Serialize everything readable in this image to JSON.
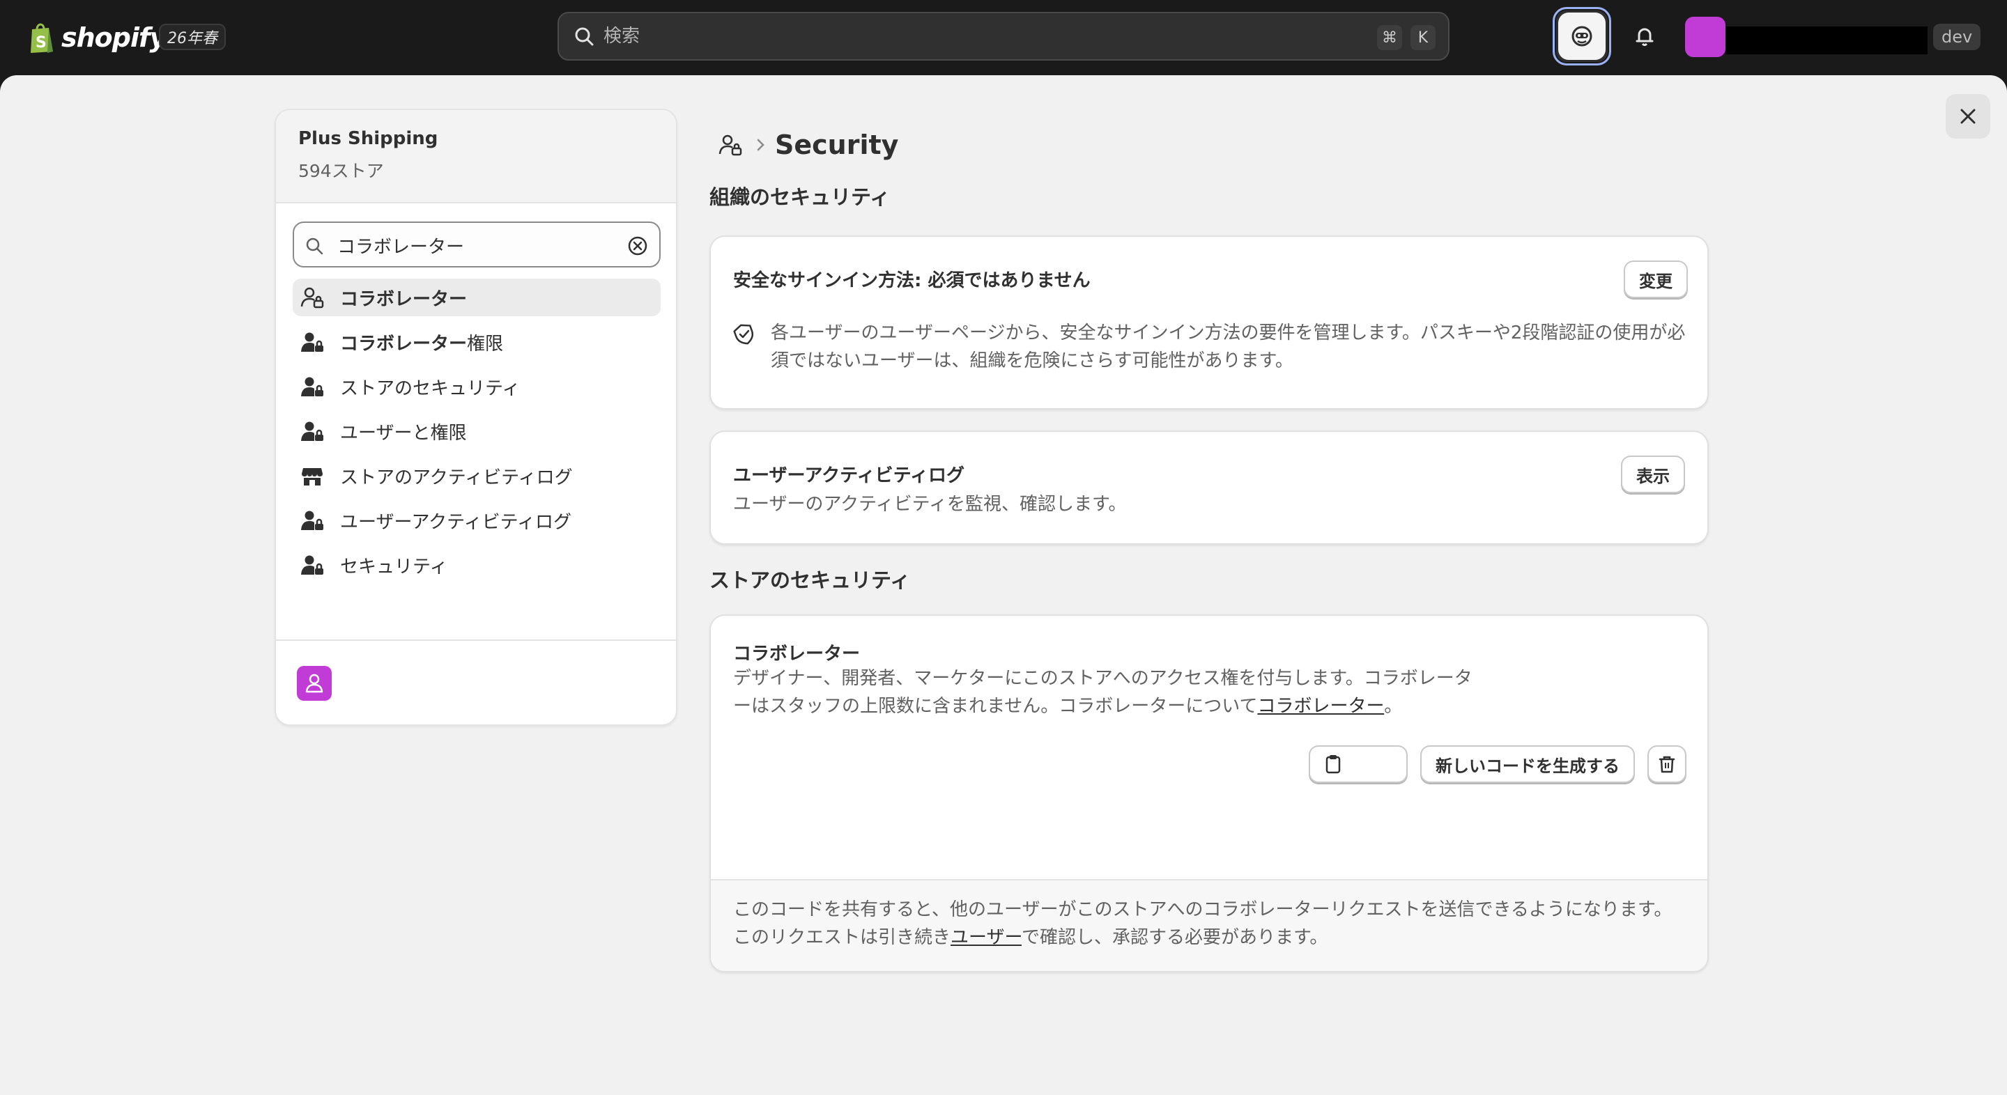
{
  "topbar": {
    "logo_text": "shopify",
    "season_badge": "26年春",
    "search_placeholder": "検索",
    "kbd_cmd": "⌘",
    "kbd_k": "K",
    "dev_badge": "dev"
  },
  "sidebar": {
    "org_name": "Plus Shipping",
    "store_count": "594ストア",
    "search_value": "コラボレーター",
    "items": [
      {
        "label": "コラボレーター",
        "icon": "person-lock-icon",
        "active": true
      },
      {
        "label_bold": "コラボレーター",
        "label_rest": "権限",
        "icon": "person-lock-filled-icon"
      },
      {
        "label": "ストアのセキュリティ",
        "icon": "person-lock-filled-icon"
      },
      {
        "label": "ユーザーと権限",
        "icon": "person-lock-filled-icon"
      },
      {
        "label": "ストアのアクティビティログ",
        "icon": "store-icon"
      },
      {
        "label": "ユーザーアクティビティログ",
        "icon": "person-lock-filled-icon"
      },
      {
        "label": "セキュリティ",
        "icon": "person-lock-filled-icon"
      }
    ]
  },
  "main": {
    "page_title": "Security",
    "org_security_heading": "組織のセキュリティ",
    "signin_card": {
      "title": "安全なサインイン方法: 必須ではありません",
      "button": "変更",
      "text_line1": "各ユーザーのユーザーページから、安全なサインイン方法の要件を管理します。パスキーや2段階認証の使用が必",
      "text_line2": "須ではないユーザーは、組織を危険にさらす可能性があります。"
    },
    "activity_card": {
      "title": "ユーザーアクティビティログ",
      "text": "ユーザーのアクティビティを監視、確認します。",
      "button": "表示"
    },
    "store_security_heading": "ストアのセキュリティ",
    "collab_card": {
      "title": "コラボレーター",
      "text_line1": "デザイナー、開発者、マーケターにこのストアへのアクセス権を付与します。コラボレータ",
      "text_line2_pre": "ーはスタッフの上限数に含まれません。コラボレーターについて",
      "text_line2_link": "コラボレーター",
      "text_line2_post": "。",
      "generate_button": "新しいコードを生成する",
      "foot_line1": "このコードを共有すると、他のユーザーがこのストアへのコラボレーターリクエストを送信できるようになります。",
      "foot_line2_pre": "このリクエストは引き続き",
      "foot_line2_link": "ユーザー",
      "foot_line2_post": "で確認し、承認する必要があります。"
    }
  },
  "colors": {
    "topbar_bg": "#1a1a1a",
    "panel_bg": "#f1f1f1",
    "avatar_purple": "#c13bd6",
    "sidekick_ring": "#9bb1f5"
  }
}
